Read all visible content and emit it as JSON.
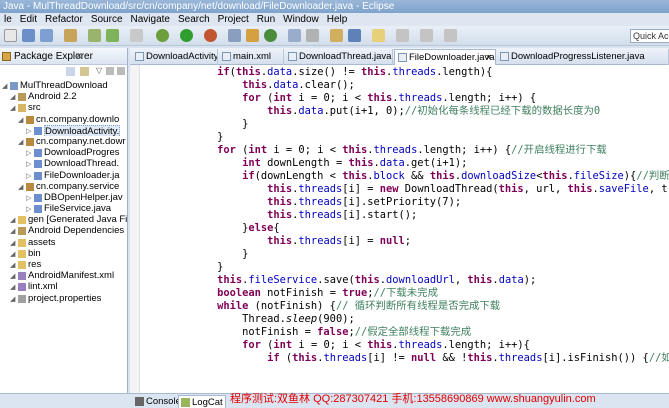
{
  "window": {
    "title": "Java - MulThreadDownload/src/cn/company/net/download/FileDownloader.java - Eclipse"
  },
  "menu": [
    "le",
    "Edit",
    "Refactor",
    "Source",
    "Navigate",
    "Search",
    "Project",
    "Run",
    "Window",
    "Help"
  ],
  "toolbar": {
    "quick_access": "Quick Acce"
  },
  "explorer": {
    "title": "Package Explorer",
    "items": [
      {
        "label": "MulThreadDownload",
        "depth": 0,
        "icon": "project-icon"
      },
      {
        "label": "Android 2.2",
        "depth": 1,
        "icon": "library-icon"
      },
      {
        "label": "src",
        "depth": 1,
        "icon": "source-folder-icon"
      },
      {
        "label": "cn.company.downlo",
        "depth": 2,
        "icon": "package-icon"
      },
      {
        "label": "DownloadActivity.",
        "depth": 3,
        "icon": "java-file-icon",
        "selected": true
      },
      {
        "label": "cn.company.net.dowr",
        "depth": 2,
        "icon": "package-icon"
      },
      {
        "label": "DownloadProgres",
        "depth": 3,
        "icon": "java-file-icon"
      },
      {
        "label": "DownloadThread.",
        "depth": 3,
        "icon": "java-file-icon"
      },
      {
        "label": "FileDownloader.ja",
        "depth": 3,
        "icon": "java-file-icon"
      },
      {
        "label": "cn.company.service",
        "depth": 2,
        "icon": "package-icon"
      },
      {
        "label": "DBOpenHelper.jav",
        "depth": 3,
        "icon": "java-file-icon"
      },
      {
        "label": "FileService.java",
        "depth": 3,
        "icon": "java-file-icon"
      },
      {
        "label": "gen [Generated Java File",
        "depth": 1,
        "icon": "folder-icon"
      },
      {
        "label": "Android Dependencies",
        "depth": 1,
        "icon": "library-icon"
      },
      {
        "label": "assets",
        "depth": 1,
        "icon": "folder-icon"
      },
      {
        "label": "bin",
        "depth": 1,
        "icon": "folder-icon"
      },
      {
        "label": "res",
        "depth": 1,
        "icon": "folder-icon"
      },
      {
        "label": "AndroidManifest.xml",
        "depth": 1,
        "icon": "xml-file-icon"
      },
      {
        "label": "lint.xml",
        "depth": 1,
        "icon": "xml-file-icon"
      },
      {
        "label": "project.properties",
        "depth": 1,
        "icon": "properties-file-icon"
      }
    ]
  },
  "editor": {
    "tabs": [
      {
        "label": "DownloadActivity.java",
        "active": false
      },
      {
        "label": "main.xml",
        "active": false
      },
      {
        "label": "DownloadThread.java",
        "active": false
      },
      {
        "label": "FileDownloader.java",
        "active": true
      },
      {
        "label": "DownloadProgressListener.java",
        "active": false
      }
    ],
    "code": [
      "            if(this.data.size() != this.threads.length){",
      "                this.data.clear();",
      "                for (int i = 0; i < this.threads.length; i++) {",
      "                    this.data.put(i+1, 0);//初始化每条线程已经下载的数据长度为0",
      "                }",
      "            }",
      "            for (int i = 0; i < this.threads.length; i++) {//开启线程进行下载",
      "                int downLength = this.data.get(i+1);",
      "                if(downLength < this.block && this.downloadSize<this.fileSize){//判断",
      "                    this.threads[i] = new DownloadThread(this, url, this.saveFile, t",
      "                    this.threads[i].setPriority(7);",
      "                    this.threads[i].start();",
      "                }else{",
      "                    this.threads[i] = null;",
      "                }",
      "            }",
      "            this.fileService.save(this.downloadUrl, this.data);",
      "            boolean notFinish = true;//下载未完成",
      "            while (notFinish) {// 循环判断所有线程是否完成下载",
      "                Thread.sleep(900);",
      "                notFinish = false;//假定全部线程下载完成",
      "                for (int i = 0; i < this.threads.length; i++){",
      "                    if (this.threads[i] != null && !this.threads[i].isFinish()) {//如"
    ]
  },
  "bottom": {
    "tabs": [
      {
        "label": "Console",
        "active": false
      },
      {
        "label": "LogCat",
        "active": true
      }
    ],
    "watermark": "程序测试:双鱼林 QQ:287307421 手机:13558690869 www.shuangyulin.com"
  },
  "colors": {
    "keyword": "#7f0055",
    "field": "#0000c0",
    "comment": "#3f7f5f",
    "watermark": "#e00000"
  }
}
